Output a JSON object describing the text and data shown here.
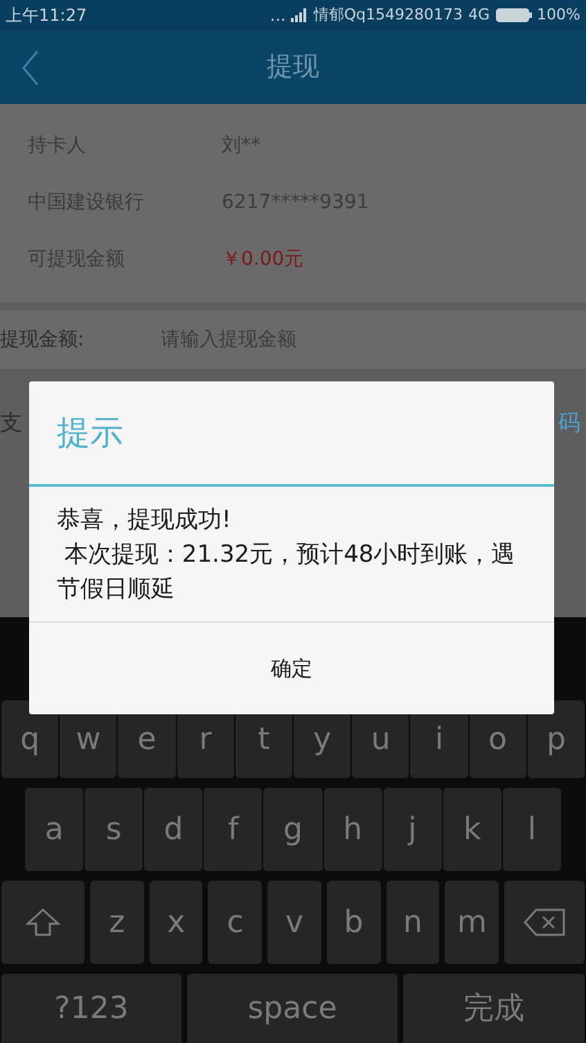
{
  "status_bar": {
    "time": "上午11:27",
    "dots": "...",
    "carrier": "情郁Qq1549280173",
    "network": "4G",
    "battery": "100%"
  },
  "header": {
    "title": "提现"
  },
  "info_rows": [
    {
      "label": "持卡人",
      "value": "刘**",
      "kind": "plain"
    },
    {
      "label": "中国建设银行",
      "value": "6217*****9391",
      "kind": "plain"
    },
    {
      "label": "可提现金额",
      "value": "￥0.00元",
      "kind": "money"
    }
  ],
  "amount_field": {
    "label": "提现金额:",
    "placeholder": "请输入提现金额"
  },
  "pay_row": {
    "label": "支",
    "trailing": "码"
  },
  "dialog": {
    "title": "提示",
    "message": [
      "恭喜，提现成功!",
      " 本次提现：21.32元，预计48小时到账，遇节假日顺延"
    ],
    "button": "确定"
  },
  "keyboard": {
    "rows": [
      [
        "q",
        "w",
        "e",
        "r",
        "t",
        "y",
        "u",
        "i",
        "o",
        "p"
      ],
      [
        "a",
        "s",
        "d",
        "f",
        "g",
        "h",
        "j",
        "k",
        "l"
      ],
      [
        "z",
        "x",
        "c",
        "v",
        "b",
        "n",
        "m"
      ]
    ],
    "mode_key": "?123",
    "space_key": "space",
    "done_key": "完成"
  }
}
